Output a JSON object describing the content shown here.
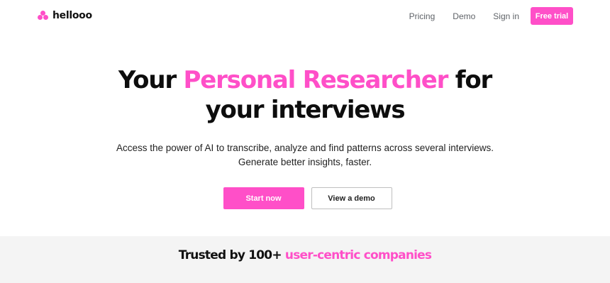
{
  "brand": {
    "name": "hellooo",
    "logo_icon": "blob-cluster-icon",
    "color": "#ff4fc8"
  },
  "nav": {
    "links": [
      "Pricing",
      "Demo",
      "Sign in"
    ],
    "cta_label": "Free trial"
  },
  "hero": {
    "headline_part1": "Your ",
    "headline_accent": "Personal Researcher",
    "headline_part2": " for",
    "headline_line2": "your interviews",
    "subtitle_line1": "Access the power of AI to transcribe, analyze and find patterns across several interviews.",
    "subtitle_line2": "Generate better insights, faster."
  },
  "cta": {
    "primary_label": "Start now",
    "secondary_label": "View a demo"
  },
  "trusted": {
    "prefix": "Trusted by 100+ ",
    "accent": "user-centric companies"
  },
  "colors": {
    "accent": "#ff4fc8",
    "text": "#111111",
    "muted": "#5f6368",
    "band": "#f4f4f4"
  }
}
